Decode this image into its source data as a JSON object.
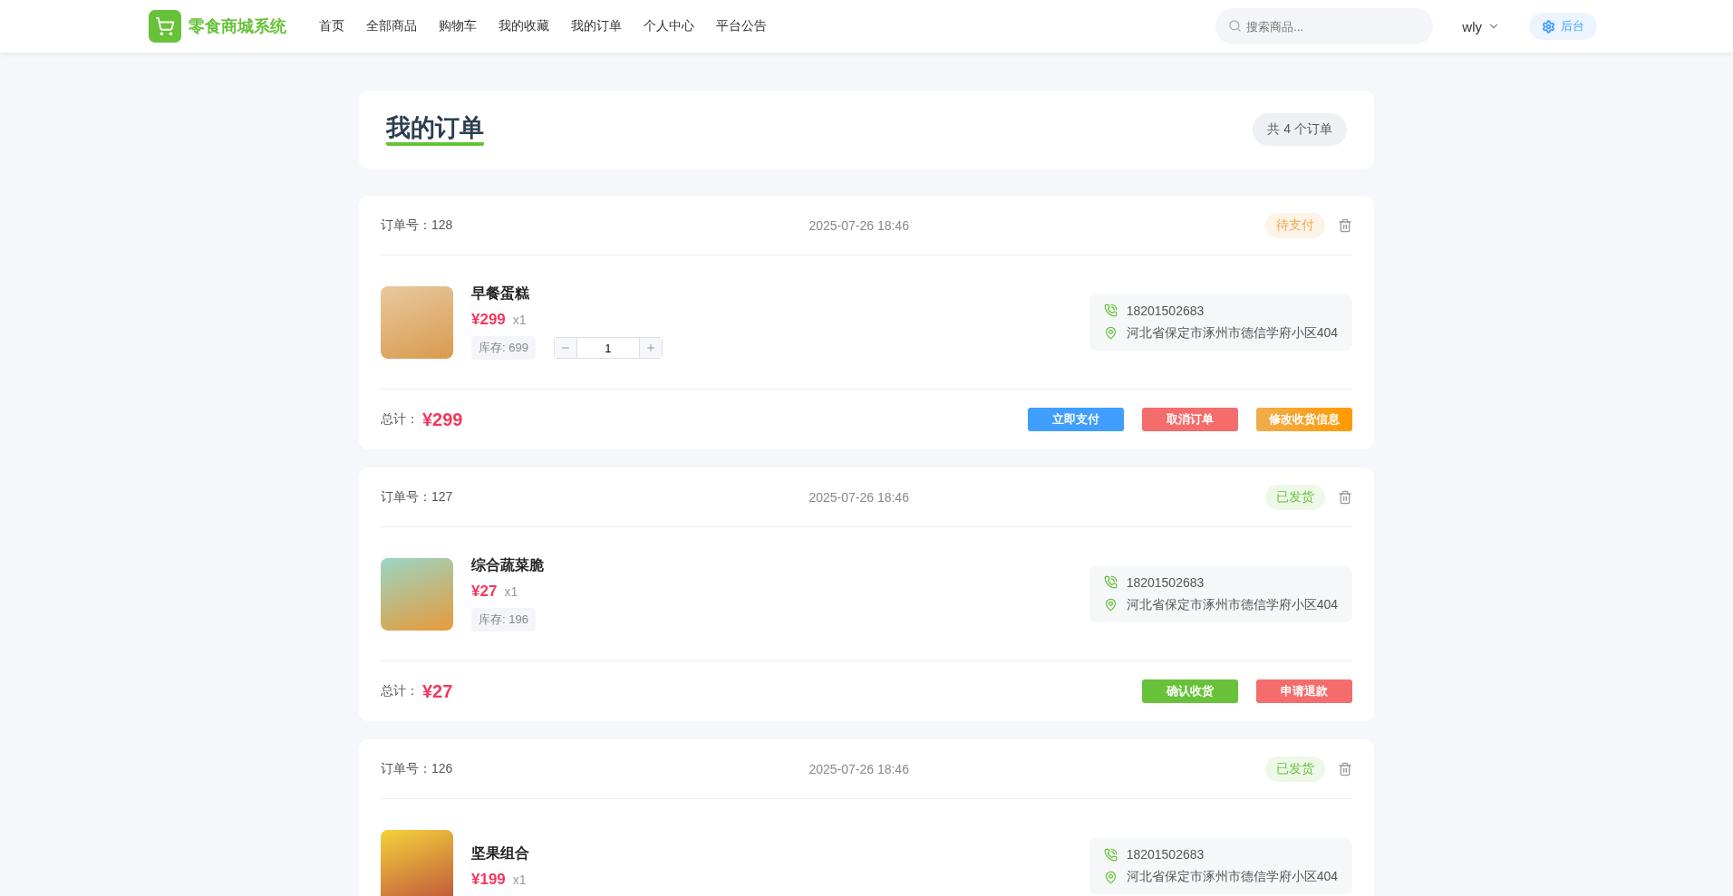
{
  "header": {
    "logo_text": "零食商城系统",
    "nav": [
      {
        "label": "首页",
        "selected": false
      },
      {
        "label": "全部商品",
        "selected": false
      },
      {
        "label": "购物车",
        "selected": false
      },
      {
        "label": "我的收藏",
        "selected": false
      },
      {
        "label": "我的订单",
        "selected": false
      },
      {
        "label": "个人中心",
        "selected": false
      },
      {
        "label": "平台公告",
        "selected": false
      }
    ],
    "search": {
      "placeholder": "搜索商品..."
    },
    "user": "wly",
    "admin_button": "后台"
  },
  "page_title": "我的订单",
  "order_count": "共 4 个订单",
  "orders": [
    {
      "order_no_label": "订单号：",
      "order_no": "128",
      "time": "2025-07-26 18:46",
      "status": {
        "kind": "pending",
        "label": "待支付"
      },
      "item": {
        "name": "早餐蛋糕",
        "price": "¥299",
        "qty": "x1",
        "stock": "库存: 699",
        "stepper": {
          "value": "1"
        }
      },
      "phone": "18201502683",
      "address": "河北省保定市涿州市德信学府小区404",
      "total_label": "总计：",
      "total": "¥299",
      "actions": [
        {
          "kind": "primary",
          "label": "立即支付"
        },
        {
          "kind": "danger",
          "label": "取消订单"
        },
        {
          "kind": "warning",
          "label": "修改收货信息"
        }
      ]
    },
    {
      "order_no_label": "订单号：",
      "order_no": "127",
      "time": "2025-07-26 18:46",
      "status": {
        "kind": "shipped",
        "label": "已发货"
      },
      "item": {
        "name": "综合蔬菜脆",
        "price": "¥27",
        "qty": "x1",
        "stock": "库存: 196"
      },
      "phone": "18201502683",
      "address": "河北省保定市涿州市德信学府小区404",
      "total_label": "总计：",
      "total": "¥27",
      "actions": [
        {
          "kind": "success",
          "label": "确认收货"
        },
        {
          "kind": "danger",
          "label": "申请退款"
        }
      ]
    },
    {
      "order_no_label": "订单号：",
      "order_no": "126",
      "time": "2025-07-26 18:46",
      "status": {
        "kind": "shipped",
        "label": "已发货"
      },
      "item": {
        "name": "坚果组合",
        "price": "¥199",
        "qty": "x1"
      },
      "phone": "18201502683",
      "address": "河北省保定市涿州市德信学府小区404"
    }
  ]
}
